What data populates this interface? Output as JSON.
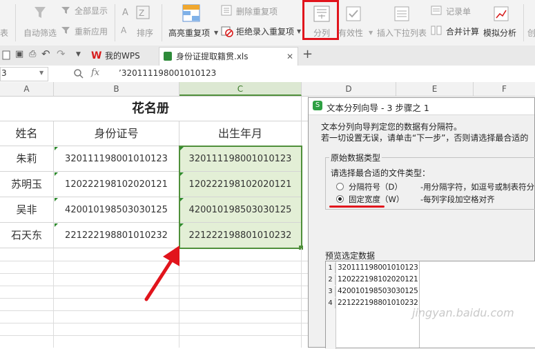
{
  "ribbon": {
    "group1": {
      "partial_label": "表",
      "autofilter_label": "自动筛选",
      "show_all_label": "全部显示",
      "reapply_label": "重新应用"
    },
    "sort": {
      "label": "排序"
    },
    "duplicates": {
      "highlight_label": "高亮重复项",
      "delete_label": "删除重复项",
      "reject_label": "拒绝录入重复项"
    },
    "text_to_columns": {
      "label": "分列"
    },
    "validity": {
      "label": "有效性"
    },
    "dropdown_list": {
      "label": "插入下拉列表"
    },
    "record_form": {
      "label": "记录单"
    },
    "consolidate": {
      "label": "合并计算"
    },
    "analysis": {
      "label": "模拟分析"
    },
    "far_right": {
      "label": "创"
    }
  },
  "tabs": {
    "wps_home": "我的WPS",
    "file": "身份证提取籍贯.xls",
    "add": "+"
  },
  "formula_bar": {
    "cell_ref": "3",
    "fx": "fx",
    "content": "’320111198001010123"
  },
  "sheet": {
    "columns": [
      "A",
      "B",
      "C",
      "D",
      "E",
      "F"
    ],
    "title": "花名册",
    "headers": [
      "姓名",
      "身份证号",
      "出生年月"
    ],
    "rows": [
      {
        "name": "朱莉",
        "id": "320111198001010123",
        "birth": "320111198001010123"
      },
      {
        "name": "苏明玉",
        "id": "120222198102020121",
        "birth": "120222198102020121"
      },
      {
        "name": "吴非",
        "id": "420010198503030125",
        "birth": "420010198503030125"
      },
      {
        "name": "石天东",
        "id": "221222198801010232",
        "birth": "221222198801010232"
      }
    ]
  },
  "dialog": {
    "title": "文本分列向导 - 3 步骤之 1",
    "desc1": "文本分列向导判定您的数据有分隔符。",
    "desc2": "若一切设置无误，请单击“下一步”，否则请选择最合适的",
    "group_label": "原始数据类型",
    "prompt": "请选择最合适的文件类型：",
    "option_delimited": "分隔符号（D）",
    "option_delimited_desc": "-用分隔字符，如逗号或制表符分隔每",
    "option_fixed": "固定宽度（W）",
    "option_fixed_desc": "-每列字段加空格对齐",
    "selected_option": "固定宽度（W）",
    "preview_label": "预览选定数据",
    "preview_rows": [
      {
        "num": "1",
        "value": "320111198001010123"
      },
      {
        "num": "2",
        "value": "120222198102020121"
      },
      {
        "num": "3",
        "value": "420010198503030125"
      },
      {
        "num": "4",
        "value": "221222198801010232"
      }
    ]
  },
  "watermark": "jingyan.baidu.com",
  "colors": {
    "accent_red": "#e1141c",
    "selection_green": "#4f8f3a",
    "selection_fill": "#e3efd6",
    "wps_red": "#d71d1d",
    "file_green": "#2e8b3a"
  }
}
